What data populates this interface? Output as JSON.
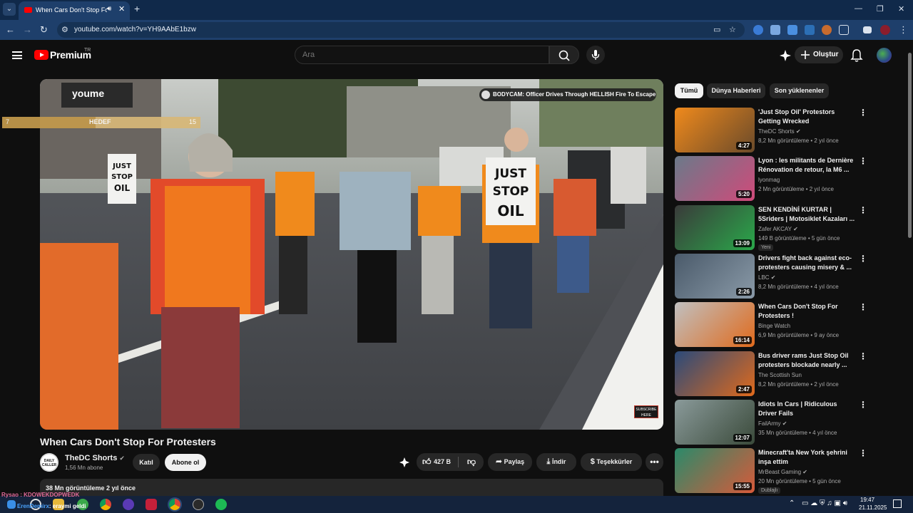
{
  "browser": {
    "tab_title": "When Cars Don't Stop For P",
    "url": "youtube.com/watch?v=YH9AAbE1bzw",
    "window_controls": [
      "minimize",
      "restore",
      "close"
    ]
  },
  "header": {
    "brand": "Premium",
    "region": "TR",
    "search_placeholder": "Ara",
    "create_label": "Oluştur"
  },
  "overlay": {
    "hedef_left": "7",
    "hedef_label": "HEDEF",
    "hedef_right": "15",
    "hedef_progress": 0.47,
    "stream_line1": "Rysao :  KDOWEKDOPWEDK",
    "stream_user": "ErenDemirx",
    "stream_line2": ": eraymi geldi"
  },
  "video": {
    "endcard_title": "BODYCAM: Officer Drives Through HELLISH Fire To Escape",
    "sign1": "JUST STOP OIL",
    "sign2": "JUST STOP OIL",
    "watermark": "SUBSCRIBE HERE",
    "title": "When Cars Don't Stop For Protesters",
    "channel": "TheDC Shorts",
    "subscribers": "1,56 Mn abone",
    "join_label": "Katıl",
    "subscribe_label": "Abone ol",
    "likes": "427 B",
    "share_label": "Paylaş",
    "download_label": "İndir",
    "thanks_label": "Teşekkürler",
    "stats": "38 Mn görüntüleme  2 yıl önce"
  },
  "chips": [
    "Tümü",
    "Dünya Haberleri",
    "Son yüklenenler"
  ],
  "recommendations": [
    {
      "title": "'Just Stop Oil' Protestors Getting Wrecked",
      "channel": "TheDC Shorts",
      "verified": true,
      "meta": "8,2 Mn görüntüleme • 2 yıl önce",
      "duration": "4:27",
      "badge": ""
    },
    {
      "title": "Lyon : les militants de Dernière Rénovation de retour, la M6 ...",
      "channel": "lyonmag",
      "verified": false,
      "meta": "2 Mn görüntüleme • 2 yıl önce",
      "duration": "5:20",
      "badge": ""
    },
    {
      "title": "SEN KENDİNİ KURTAR | 5Sriders | Motosiklet Kazaları ...",
      "channel": "Zafer AKCAY",
      "verified": true,
      "meta": "149 B görüntüleme • 5 gün önce",
      "duration": "13:09",
      "badge": "Yeni"
    },
    {
      "title": "Drivers fight back against eco-protesters causing misery & ...",
      "channel": "LBC",
      "verified": true,
      "meta": "8,2 Mn görüntüleme • 4 yıl önce",
      "duration": "2:26",
      "badge": ""
    },
    {
      "title": "When Cars Don't Stop For Protesters !",
      "channel": "Binge Watch",
      "verified": false,
      "meta": "6,9 Mn görüntüleme • 9 ay önce",
      "duration": "16:14",
      "badge": ""
    },
    {
      "title": "Bus driver rams Just Stop Oil protesters blockade nearly ...",
      "channel": "The Scottish Sun",
      "verified": false,
      "meta": "8,2 Mn görüntüleme • 2 yıl önce",
      "duration": "2:47",
      "badge": ""
    },
    {
      "title": "Idiots In Cars | Ridiculous Driver Fails",
      "channel": "FailArmy",
      "verified": true,
      "meta": "35 Mn görüntüleme • 4 yıl önce",
      "duration": "12:07",
      "badge": ""
    },
    {
      "title": "Minecraft'ta New York şehrini inşa ettim",
      "channel": "MrBeast Gaming",
      "verified": true,
      "meta": "20 Mn görüntüleme • 5 gün önce",
      "duration": "15:55",
      "badge": "Dublajlı"
    }
  ],
  "taskbar": {
    "time": "19:47",
    "date": "21.11.2025"
  },
  "colors": {
    "accent_red": "#ff0000",
    "chrome_blue": "#1e3f6b",
    "bg": "#0f0f0f"
  }
}
